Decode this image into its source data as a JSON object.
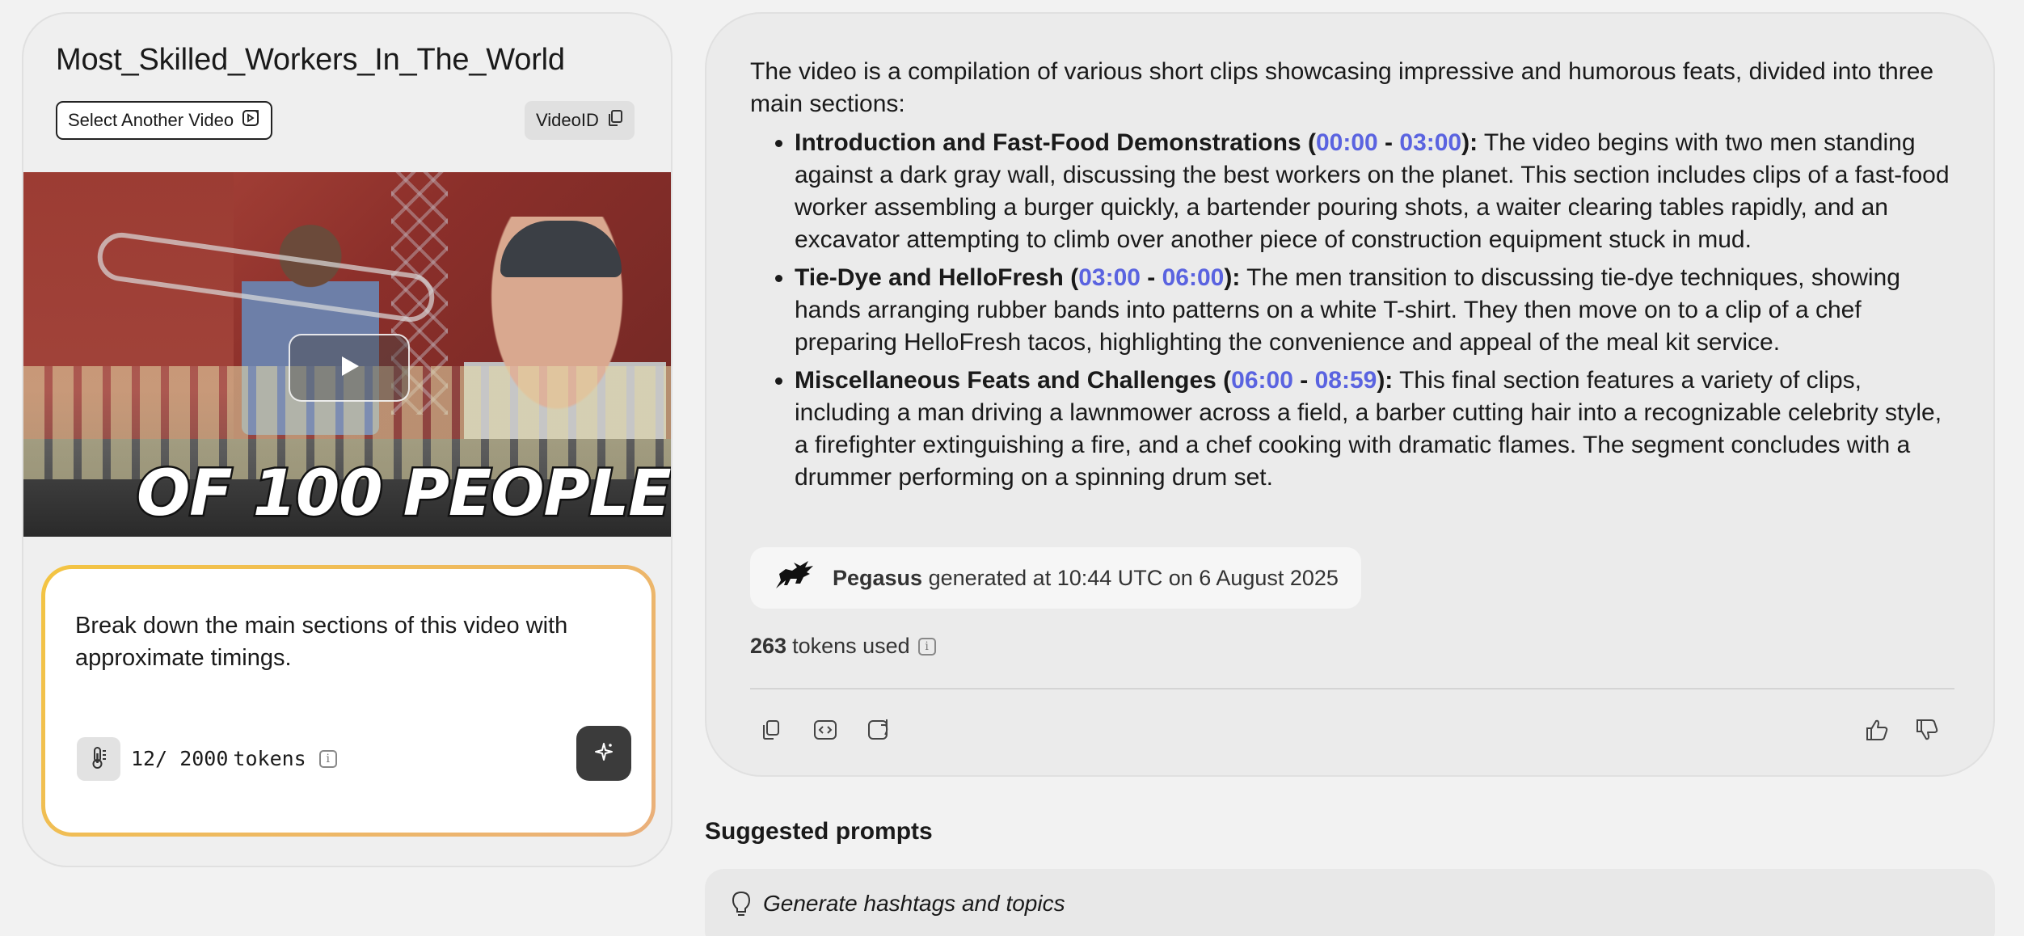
{
  "left": {
    "video_title": "Most_Skilled_Workers_In_The_World",
    "select_video_label": "Select Another Video",
    "video_id_label": "VideoID",
    "thumbnail_caption": "OF 100 PEOPLE",
    "prompt": {
      "text": "Break down the main sections of this video with approximate timings.",
      "token_count": "12/ 2000",
      "token_unit": "tokens"
    }
  },
  "answer": {
    "intro": "The video is a compilation of various short clips showcasing impressive and humorous feats, divided into three main sections:",
    "sections": [
      {
        "title": "Introduction and Fast-Food Demonstrations",
        "start": "00:00",
        "end": "03:00",
        "body": "The video begins with two men standing against a dark gray wall, discussing the best workers on the planet. This section includes clips of a fast-food worker assembling a burger quickly, a bartender pouring shots, a waiter clearing tables rapidly, and an excavator attempting to climb over another piece of construction equipment stuck in mud."
      },
      {
        "title": "Tie-Dye and HelloFresh",
        "start": "03:00",
        "end": "06:00",
        "body": "The men transition to discussing tie-dye techniques, showing hands arranging rubber bands into patterns on a white T-shirt. They then move on to a clip of a chef preparing HelloFresh tacos, highlighting the convenience and appeal of the meal kit service."
      },
      {
        "title": "Miscellaneous Feats and Challenges",
        "start": "06:00",
        "end": "08:59",
        "body": "This final section features a variety of clips, including a man driving a lawnmower across a field, a barber cutting hair into a recognizable celebrity style, a firefighter extinguishing a fire, and a chef cooking with dramatic flames. The segment concludes with a drummer performing on a spinning drum set."
      }
    ],
    "model_name": "Pegasus",
    "generated_text": "generated at 10:44 UTC on 6 August 2025",
    "tokens_used_count": "263",
    "tokens_used_label": "tokens used"
  },
  "suggested": {
    "title": "Suggested prompts",
    "items": [
      "Generate hashtags and topics"
    ]
  },
  "colors": {
    "timestamp": "#5a63e0",
    "prompt_border_start": "#f3c442",
    "prompt_border_end": "#eab07b",
    "send_button": "#3b3b3b"
  },
  "icons": {
    "select_video": "video-swap-icon",
    "video_id": "copy-icon",
    "play": "play-icon",
    "temperature": "thermometer-icon",
    "info": "info-icon",
    "send": "sparkle-icon",
    "model": "pegasus-logo-icon",
    "copy": "copy-icon",
    "embed": "code-icon",
    "regenerate": "refresh-icon",
    "like": "thumbs-up-icon",
    "dislike": "thumbs-down-icon",
    "suggestion": "lightbulb-icon"
  }
}
